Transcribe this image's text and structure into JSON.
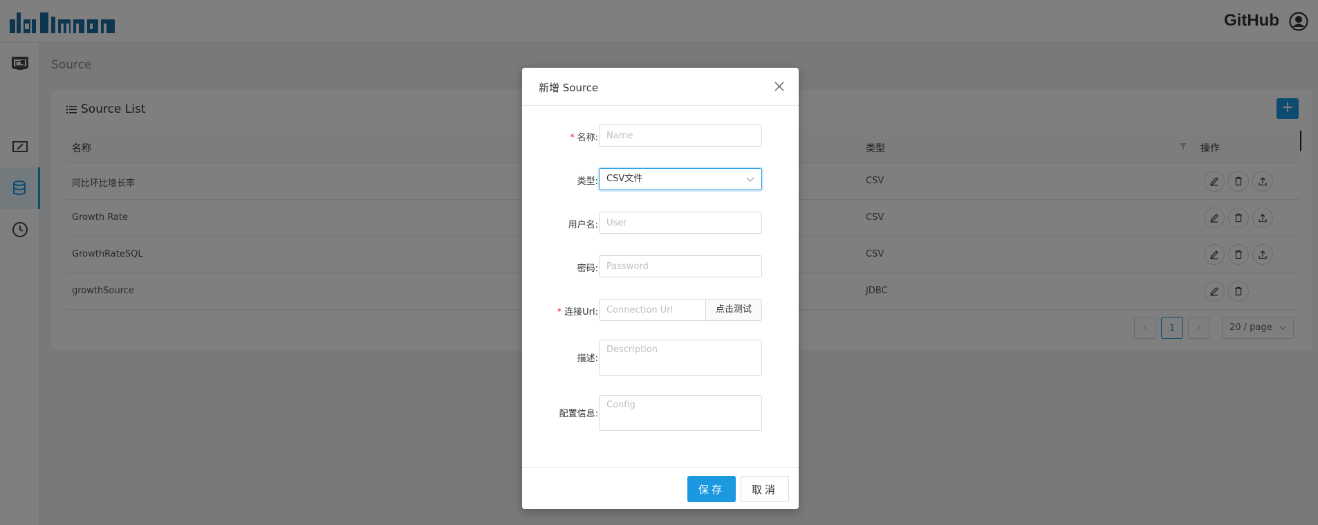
{
  "header": {
    "github_label": "GitHub"
  },
  "breadcrumb": "Source",
  "card": {
    "title": "Source List",
    "add_label": "+",
    "add_tooltip": "新增"
  },
  "table": {
    "columns": [
      "名称",
      "类型",
      "操作"
    ],
    "rows": [
      {
        "name": "同比环比增长率",
        "type": "CSV"
      },
      {
        "name": "Growth Rate",
        "type": "CSV"
      },
      {
        "name": "GrowthRateSQL",
        "type": "CSV"
      },
      {
        "name": "growthSource",
        "type": "JDBC"
      }
    ]
  },
  "pagination": {
    "current": "1",
    "page_size": "20 / page"
  },
  "modal": {
    "title": "新增 Source",
    "fields": {
      "name": {
        "label": "名称:",
        "placeholder": "Name",
        "required": true
      },
      "type": {
        "label": "类型:",
        "value": "CSV文件"
      },
      "user": {
        "label": "用户名:",
        "placeholder": "User"
      },
      "password": {
        "label": "密码:",
        "placeholder": "Password"
      },
      "url": {
        "label": "连接Url:",
        "placeholder": "Connection Url",
        "test_button": "点击测试",
        "required": true
      },
      "description": {
        "label": "描述:",
        "placeholder": "Description"
      },
      "config": {
        "label": "配置信息:",
        "placeholder": "Config"
      }
    },
    "save_label": "保存",
    "cancel_label": "取消"
  },
  "colors": {
    "accent": "#1b98e0",
    "required": "#f5222d"
  }
}
